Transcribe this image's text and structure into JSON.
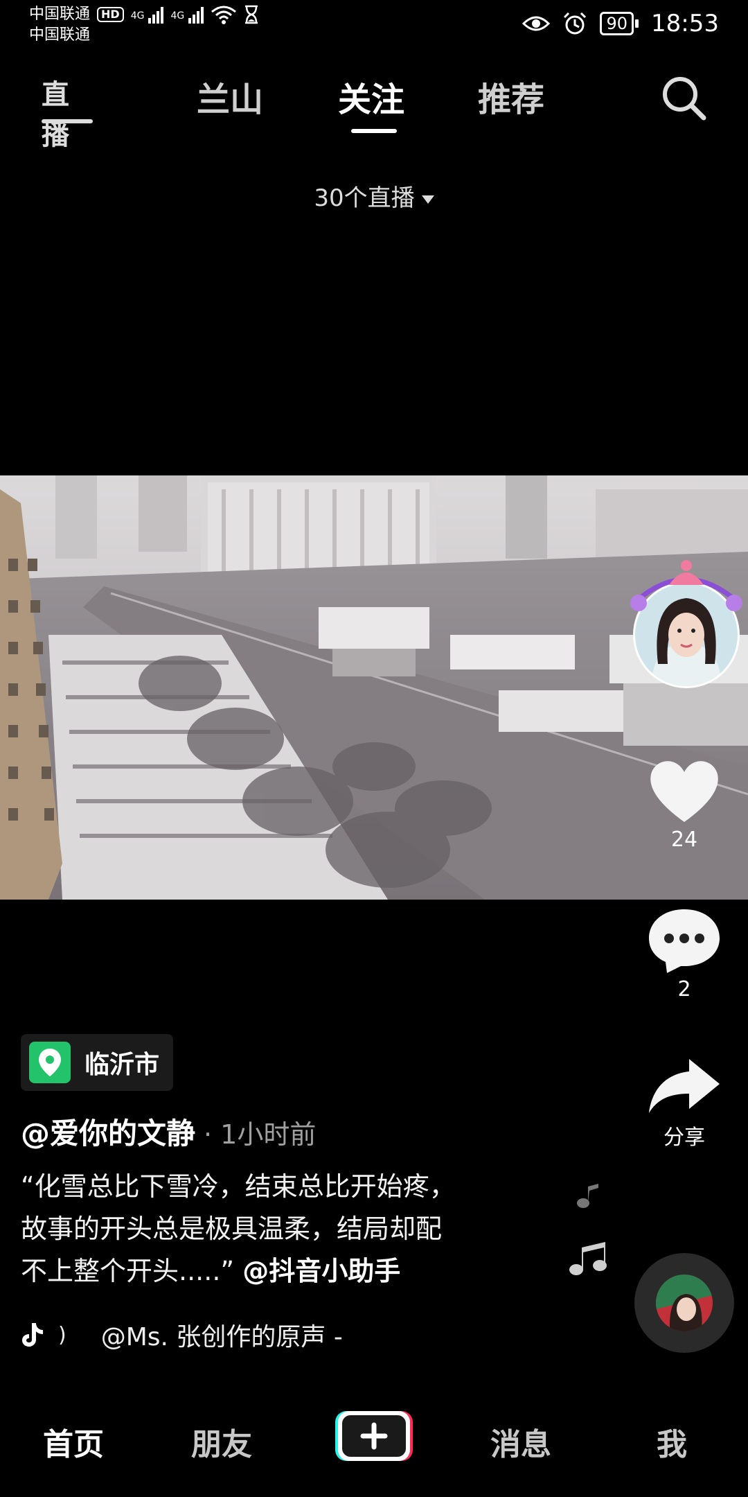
{
  "status_bar": {
    "carrier1": "中国联通",
    "carrier2": "中国联通",
    "hd": "HD",
    "net1": "4G",
    "net2": "4G",
    "battery": "90",
    "time": "18:53"
  },
  "top_nav": {
    "live_icon_label": "直播",
    "tabs": [
      {
        "label": "兰山",
        "active": false
      },
      {
        "label": "关注",
        "active": true
      },
      {
        "label": "推荐",
        "active": false
      }
    ]
  },
  "live_count": "30个直播",
  "video": {
    "likes": "24",
    "comments": "2",
    "share_label": "分享"
  },
  "post": {
    "location": "临沂市",
    "author": "@爱你的文静",
    "time": "· 1小时前",
    "caption_lines": [
      "“化雪总比下雪冷，结束总比开始疼，",
      "故事的开头总是极具温柔，结局却配",
      "不上整个开头.....”"
    ],
    "mention": "@抖音小助手",
    "music": "@Ms. 张创作的原声 -"
  },
  "bottom_nav": {
    "home": "首页",
    "friends": "朋友",
    "messages": "消息",
    "me": "我"
  },
  "colors": {
    "background": "#000000",
    "location_green": "#22c36a",
    "plus_cyan": "#25f4ee",
    "plus_red": "#fe2c55"
  }
}
